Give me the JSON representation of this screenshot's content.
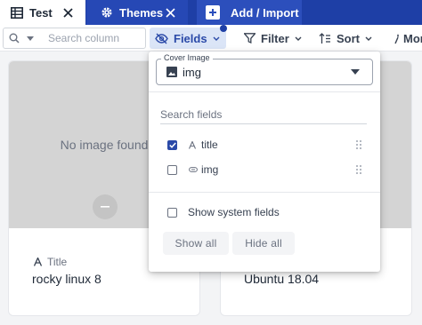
{
  "tabs": [
    {
      "label": "Test",
      "icon": "table-icon",
      "active": true
    },
    {
      "label": "Themes",
      "icon": "gear-icon",
      "active": false
    },
    {
      "label": "Add / Import",
      "icon": "plus-icon",
      "active": false
    }
  ],
  "toolbar": {
    "search_placeholder": "Search column",
    "fields_label": "Fields",
    "filter_label": "Filter",
    "sort_label": "Sort",
    "more_label": "Mor"
  },
  "cards": [
    {
      "no_image": "No image found",
      "field_label": "Title",
      "field_value": "rocky linux 8"
    },
    {
      "field_value": "Ubuntu 18.04"
    }
  ],
  "fields_menu": {
    "cover_label": "Cover Image",
    "cover_value": "img",
    "search_placeholder": "Search fields",
    "fields": [
      {
        "label": "title",
        "checked": true,
        "icon": "text-type-icon"
      },
      {
        "label": "img",
        "checked": false,
        "icon": "attachment-icon"
      }
    ],
    "show_system_label": "Show system fields",
    "show_system_checked": false,
    "show_all_label": "Show all",
    "hide_all_label": "Hide all"
  },
  "colors": {
    "brand": "#1e3fa6",
    "accent": "#2b4aa8",
    "fields_active_bg": "#dbe5f7"
  }
}
